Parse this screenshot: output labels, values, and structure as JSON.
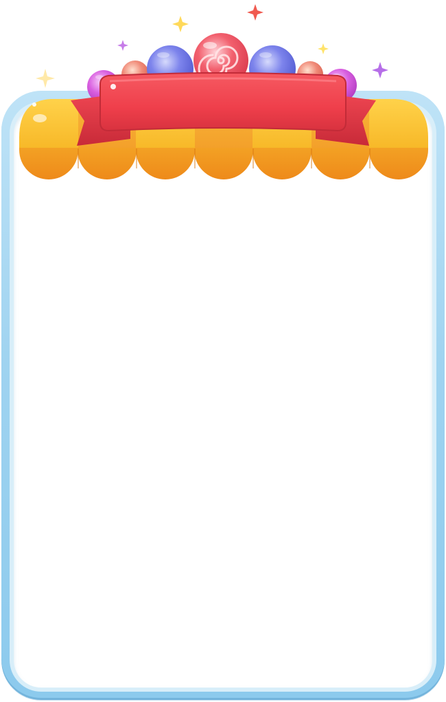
{
  "scene": {
    "type": "candy-themed popup frame",
    "title_text": "",
    "body_text": "",
    "colors": {
      "frame_blue": "#9fd3f0",
      "frame_light": "#d8eef9",
      "panel": "#ffffff",
      "awning_yellow": "#f9be2a",
      "awning_orange": "#f0921d",
      "ribbon_red": "#f0434d",
      "ribbon_dark": "#c22b38",
      "candy_pink": "#f2606e",
      "candy_blue": "#7d84ec",
      "candy_magenta": "#d95fe0"
    },
    "decorations": {
      "awning_scallop_count": 7,
      "candy_count": 7,
      "sparkle_count": 7,
      "icons": [
        "swirl-lollipop-icon",
        "candy-ball-icon",
        "sparkle-icon",
        "ribbon-banner"
      ]
    }
  }
}
